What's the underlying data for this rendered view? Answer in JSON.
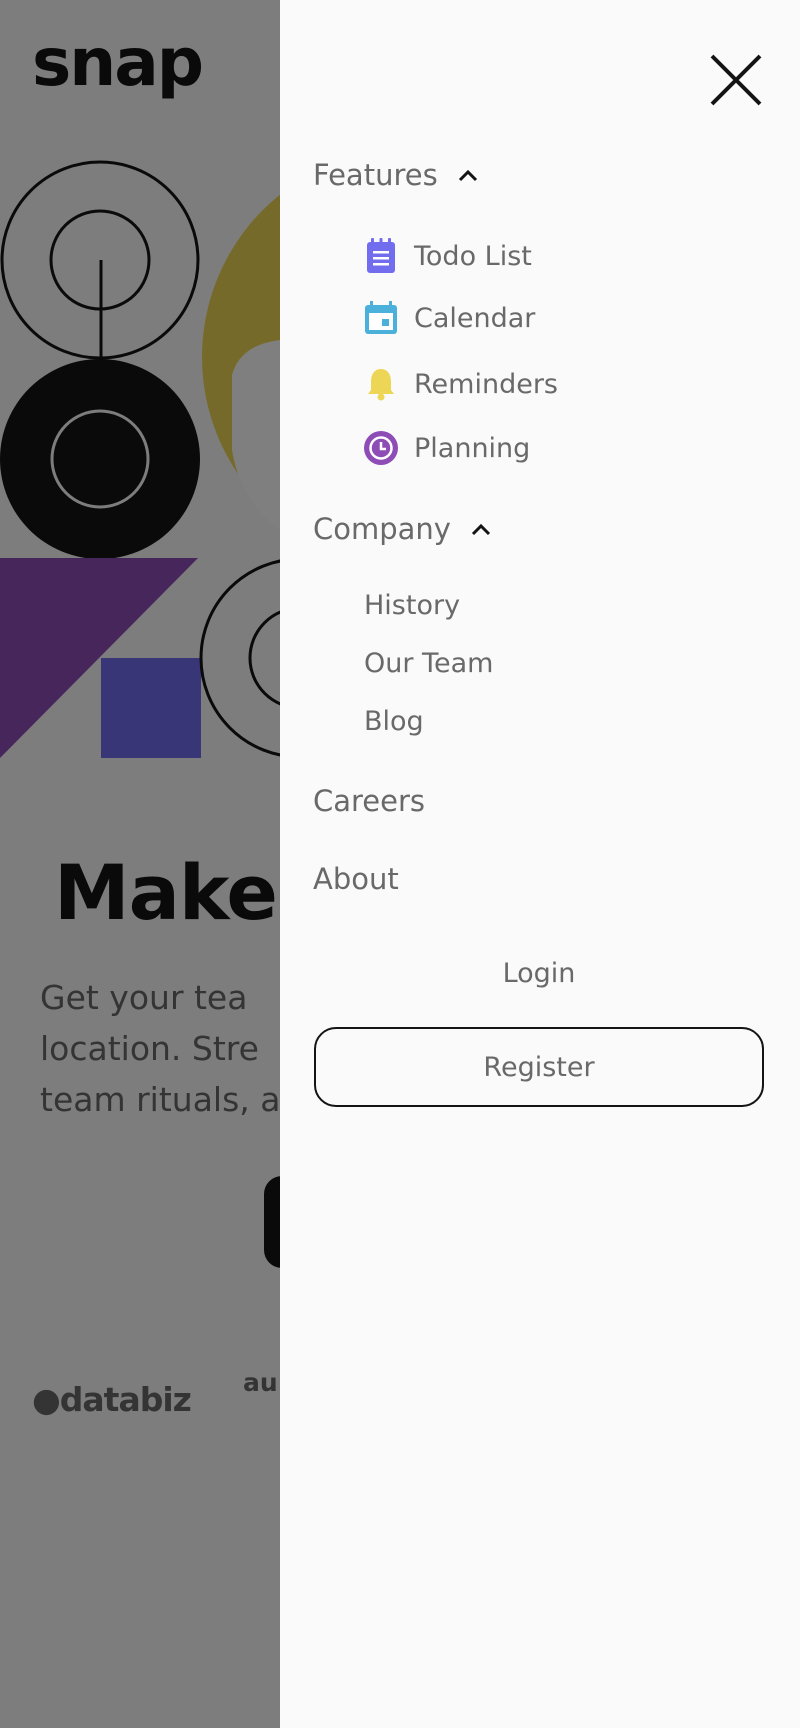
{
  "brand": {
    "logo": "snap"
  },
  "hero": {
    "title_visible": "Make r",
    "text_visible": "Get your tea\nlocation. Stre\nteam rituals, a"
  },
  "clients": {
    "databiz": "●databiz",
    "audiophile_visible": "au p"
  },
  "menu": {
    "features": {
      "label": "Features",
      "expanded": true,
      "items": [
        {
          "label": "Todo List",
          "icon": "todo-list-icon",
          "color": "#726CEE"
        },
        {
          "label": "Calendar",
          "icon": "calendar-icon",
          "color": "#4BB1DA"
        },
        {
          "label": "Reminders",
          "icon": "bell-icon",
          "color": "#EDD556"
        },
        {
          "label": "Planning",
          "icon": "clock-icon",
          "color": "#8E4CB6"
        }
      ]
    },
    "company": {
      "label": "Company",
      "expanded": true,
      "items": [
        {
          "label": "History"
        },
        {
          "label": "Our Team"
        },
        {
          "label": "Blog"
        }
      ]
    },
    "careers": "Careers",
    "about": "About",
    "login": "Login",
    "register": "Register"
  },
  "colors": {
    "text_dark": "#141414",
    "text_medium_gray": "#696969",
    "background": "#FAFAFA",
    "overlay": "rgba(0,0,0,0.5)"
  }
}
